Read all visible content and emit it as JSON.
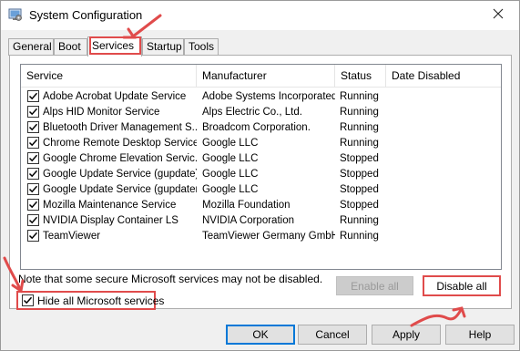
{
  "window": {
    "title": "System Configuration",
    "icon": "system-configuration-app-icon",
    "close_icon": "close-icon"
  },
  "tabs": [
    {
      "label": "General",
      "active": false
    },
    {
      "label": "Boot",
      "active": false
    },
    {
      "label": "Services",
      "active": true
    },
    {
      "label": "Startup",
      "active": false
    },
    {
      "label": "Tools",
      "active": false
    }
  ],
  "services": {
    "columns": [
      "Service",
      "Manufacturer",
      "Status",
      "Date Disabled"
    ],
    "rows": [
      {
        "checked": true,
        "service": "Adobe Acrobat Update Service",
        "manufacturer": "Adobe Systems Incorporated",
        "status": "Running",
        "date_disabled": ""
      },
      {
        "checked": true,
        "service": "Alps HID Monitor Service",
        "manufacturer": "Alps Electric Co., Ltd.",
        "status": "Running",
        "date_disabled": ""
      },
      {
        "checked": true,
        "service": "Bluetooth Driver Management S...",
        "manufacturer": "Broadcom Corporation.",
        "status": "Running",
        "date_disabled": ""
      },
      {
        "checked": true,
        "service": "Chrome Remote Desktop Service",
        "manufacturer": "Google LLC",
        "status": "Running",
        "date_disabled": ""
      },
      {
        "checked": true,
        "service": "Google Chrome Elevation Servic...",
        "manufacturer": "Google LLC",
        "status": "Stopped",
        "date_disabled": ""
      },
      {
        "checked": true,
        "service": "Google Update Service (gupdate)",
        "manufacturer": "Google LLC",
        "status": "Stopped",
        "date_disabled": ""
      },
      {
        "checked": true,
        "service": "Google Update Service (gupdatem)",
        "manufacturer": "Google LLC",
        "status": "Stopped",
        "date_disabled": ""
      },
      {
        "checked": true,
        "service": "Mozilla Maintenance Service",
        "manufacturer": "Mozilla Foundation",
        "status": "Stopped",
        "date_disabled": ""
      },
      {
        "checked": true,
        "service": "NVIDIA Display Container LS",
        "manufacturer": "NVIDIA Corporation",
        "status": "Running",
        "date_disabled": ""
      },
      {
        "checked": true,
        "service": "TeamViewer",
        "manufacturer": "TeamViewer Germany GmbH",
        "status": "Running",
        "date_disabled": ""
      }
    ]
  },
  "note": "Note that some secure Microsoft services may not be disabled.",
  "hide_ms": {
    "label": "Hide all Microsoft services",
    "checked": true
  },
  "buttons": {
    "enable_all": "Enable all",
    "disable_all": "Disable all",
    "ok": "OK",
    "cancel": "Cancel",
    "apply": "Apply",
    "help": "Help"
  },
  "colors": {
    "annotation": "#e04b4b",
    "default_button_border": "#0078d7"
  }
}
